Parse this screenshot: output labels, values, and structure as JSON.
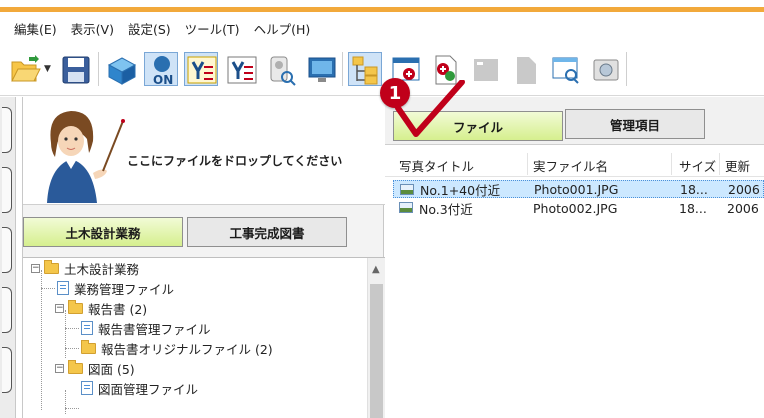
{
  "menu": {
    "items": [
      "編集(E)",
      "表示(V)",
      "設定(S)",
      "ツール(T)",
      "ヘルプ(H)"
    ]
  },
  "toolbar": {
    "icons": [
      "open-folder-icon",
      "save-icon",
      "box-icon",
      "on-icon",
      "ye-icon-1",
      "ye-icon-2",
      "person-search-icon",
      "monitor-icon",
      "tree-icon",
      "window-add-icon",
      "doc-add-icon",
      "gray-square-icon",
      "gray-page-icon",
      "window-search-icon",
      "image-icon"
    ]
  },
  "drop_zone": {
    "text": "ここにファイルをドロップしてください"
  },
  "left_tabs": [
    {
      "label": "土木設計業務",
      "active": true
    },
    {
      "label": "工事完成図書",
      "active": false
    }
  ],
  "tree": {
    "nodes": [
      {
        "label": "土木設計業務",
        "type": "folder",
        "expander": "−"
      },
      {
        "label": "業務管理ファイル",
        "type": "doc"
      },
      {
        "label": "報告書 (2)",
        "type": "folder",
        "expander": "−"
      },
      {
        "label": "報告書管理ファイル",
        "type": "doc"
      },
      {
        "label": "報告書オリジナルファイル (2)",
        "type": "folder"
      },
      {
        "label": "図面 (5)",
        "type": "folder",
        "expander": "−"
      },
      {
        "label": "図面管理ファイル",
        "type": "doc"
      }
    ]
  },
  "right_tabs": [
    {
      "label": "ファイル",
      "active": true
    },
    {
      "label": "管理項目",
      "active": false
    }
  ],
  "file_list": {
    "columns": [
      "写真タイトル",
      "実ファイル名",
      "サイズ",
      "更新"
    ],
    "rows": [
      {
        "title": "No.1+40付近",
        "filename": "Photo001.JPG",
        "size": "18...",
        "updated": "2006",
        "selected": true
      },
      {
        "title": "No.3付近",
        "filename": "Photo002.JPG",
        "size": "18...",
        "updated": "2006",
        "selected": false
      }
    ]
  },
  "callout": {
    "number": "1"
  },
  "colors": {
    "accent_orange": "#f2a93b",
    "tab_green": "#d6ef8e",
    "selection": "#cce8ff",
    "callout_red": "#c0001a"
  }
}
